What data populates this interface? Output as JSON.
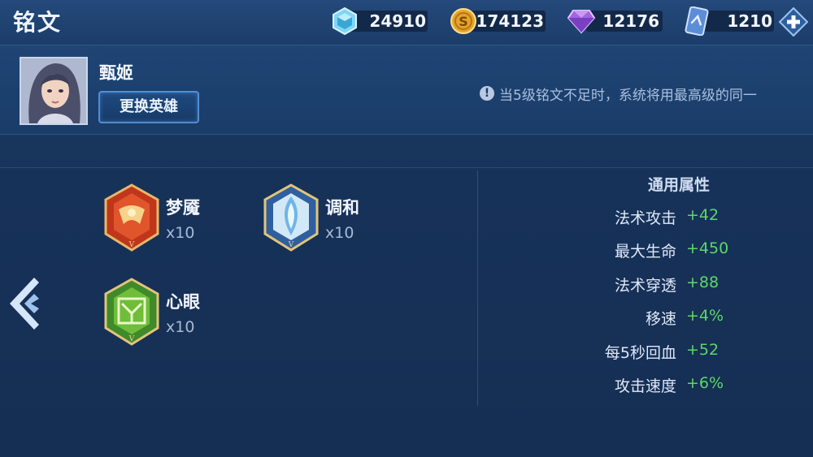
{
  "header": {
    "title": "铭文"
  },
  "resources": [
    {
      "icon": "crystal-icon",
      "value": "24910"
    },
    {
      "icon": "gold-coin-icon",
      "value": "174123"
    },
    {
      "icon": "diamond-icon",
      "value": "12176"
    },
    {
      "icon": "voucher-icon",
      "value": "1210"
    }
  ],
  "hero": {
    "name": "甄姬",
    "change_label": "更换英雄"
  },
  "notice": {
    "text": "当5级铭文不足时，系统将用最高级的同一"
  },
  "runes": [
    {
      "name": "梦魇",
      "count": "x10",
      "color": "#c0361b"
    },
    {
      "name": "调和",
      "count": "x10",
      "color": "#3a6fb8"
    },
    {
      "name": "心眼",
      "count": "x10",
      "color": "#3f8a2a"
    }
  ],
  "attributes": {
    "title": "通用属性",
    "items": [
      {
        "name": "法术攻击",
        "value": "+42"
      },
      {
        "name": "最大生命",
        "value": "+450"
      },
      {
        "name": "法术穿透",
        "value": "+88"
      },
      {
        "name": "移速",
        "value": "+4%"
      },
      {
        "name": "每5秒回血",
        "value": "+52"
      },
      {
        "name": "攻击速度",
        "value": "+6%"
      }
    ]
  },
  "colors": {
    "value_green": "#5fd66a",
    "accent_blue": "#4f8ed4"
  }
}
